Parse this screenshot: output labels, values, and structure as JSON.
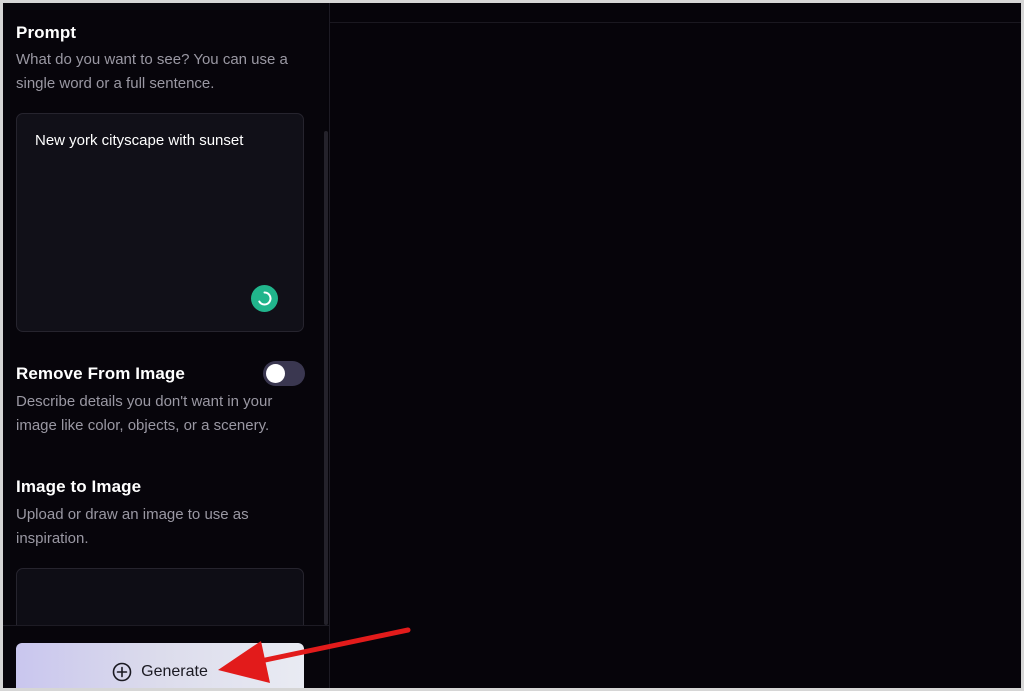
{
  "prompt_section": {
    "title": "Prompt",
    "description": "What do you want to see? You can use a single word or a full sentence.",
    "input_value": "New york cityscape with sunset"
  },
  "remove_section": {
    "title": "Remove From Image",
    "description": "Describe details you don't want in your image like color, objects, or a scenery.",
    "toggle_on": false
  },
  "image_to_image_section": {
    "title": "Image to Image",
    "description": "Upload or draw an image to use as inspiration."
  },
  "generate_button": {
    "label": "Generate",
    "icon": "plus-circle-icon"
  },
  "colors": {
    "background": "#06040a",
    "accent_green": "#21b58c",
    "annotation_red": "#e21b1b"
  }
}
